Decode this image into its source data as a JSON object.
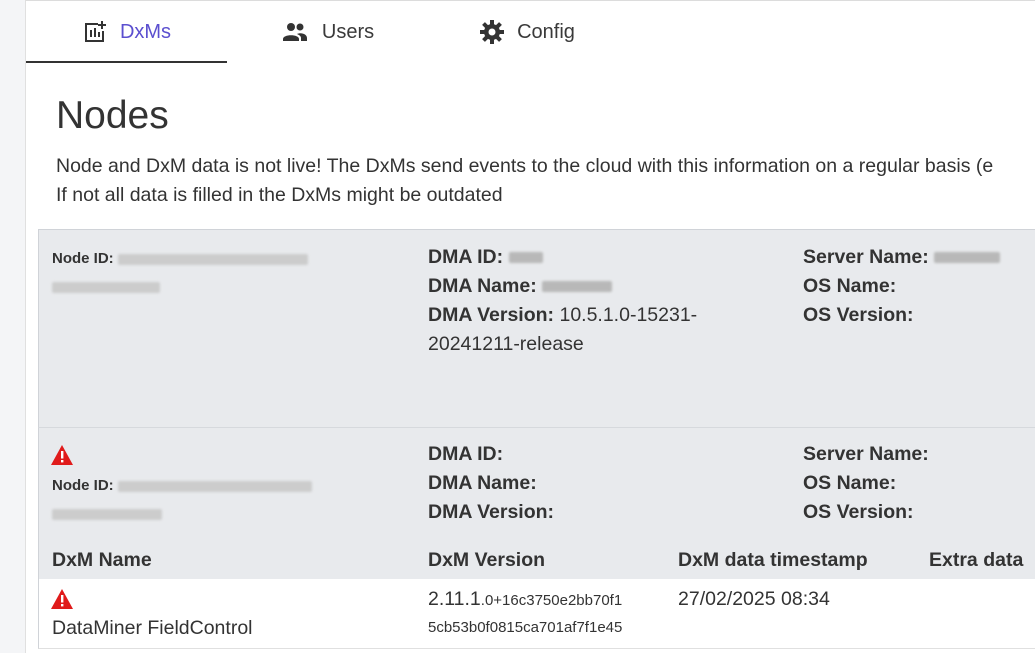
{
  "tabs": [
    {
      "label": "DxMs",
      "icon": "chart-plus-icon",
      "active": true
    },
    {
      "label": "Users",
      "icon": "users-icon",
      "active": false
    },
    {
      "label": "Config",
      "icon": "gear-icon",
      "active": false
    }
  ],
  "page": {
    "title": "Nodes",
    "intro_line1": "Node and DxM data is not live! The DxMs send events to the cloud with this information on a regular basis (e",
    "intro_line2": "If not all data is filled in the DxMs might be outdated"
  },
  "labels": {
    "node_id": "Node ID:",
    "dma_id": "DMA ID:",
    "dma_name": "DMA Name:",
    "dma_version": "DMA Version:",
    "server_name": "Server Name:",
    "os_name": "OS Name:",
    "os_version": "OS Version:"
  },
  "nodes": [
    {
      "warning": false,
      "dma_version": "10.5.1.0-15231-",
      "dma_version_cont": "20241211-release"
    },
    {
      "warning": true,
      "dma_version": "",
      "dma_version_cont": ""
    }
  ],
  "table": {
    "headers": [
      "DxM Name",
      "DxM Version",
      "DxM data timestamp",
      "Extra data"
    ],
    "rows": [
      {
        "warning": true,
        "name": "DataMiner FieldControl",
        "version_main": "2.11.1",
        "version_suffix": ".0+16c3750e2bb70f1",
        "version_line2": "5cb53b0f0815ca701af7f1e45",
        "timestamp": "27/02/2025 08:34",
        "extra": ""
      }
    ]
  },
  "colors": {
    "accent": "#5b4fcf",
    "warning": "#e01b1b",
    "panel": "#e8eaed"
  }
}
